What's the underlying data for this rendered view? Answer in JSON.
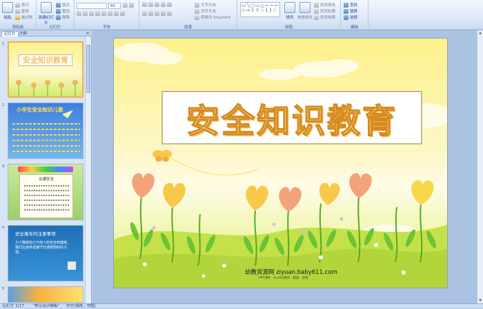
{
  "ribbon": {
    "clipboard": {
      "label": "剪贴板",
      "paste": "粘贴",
      "cut": "剪切",
      "copy": "复制",
      "format_painter": "格式刷"
    },
    "slides": {
      "label": "幻灯片",
      "new_slide": "新建幻灯片",
      "layout": "版式",
      "reset": "重设",
      "delete": "删除"
    },
    "font": {
      "label": "字体",
      "size": "80"
    },
    "paragraph": {
      "label": "段落",
      "text_direction": "文字方向",
      "align_text": "对齐文本",
      "smartart": "转换为 SmartArt"
    },
    "drawing": {
      "label": "绘图",
      "arrange": "排列",
      "quick_styles": "快速样式",
      "shape_fill": "形状填充",
      "shape_outline": "形状轮廓",
      "shape_effects": "形状效果"
    },
    "editing": {
      "label": "编辑",
      "find": "查找",
      "replace": "替换",
      "select": "选择"
    }
  },
  "panel": {
    "tab_slides": "幻灯片",
    "tab_outline": "大纲",
    "close": "×",
    "thumbs": [
      {
        "num": "1",
        "title": "安全知识教育"
      },
      {
        "num": "2",
        "title": "小学生安全知识儿歌"
      },
      {
        "num": "3",
        "title": "交通安全"
      },
      {
        "num": "4",
        "title": "安全乘车的注意事项",
        "body": "为了确保自己与他人的安全和健康，我们应该养成遵守交通规则的好习惯。"
      },
      {
        "num": "5"
      }
    ]
  },
  "slide": {
    "title": "安全知识教育",
    "footer": "幼教资源网 ziyuan.baby611.com",
    "footer_sub": "PPT课件 · FLASH课件 · 教案 · 试卷"
  },
  "status": {
    "slide_num": "幻灯片 1/17",
    "theme": "\"默认设计模板\"",
    "language": "中文(简体，中国)"
  },
  "colors": {
    "title_fill": "#fff4c0",
    "title_outline": "#d68a1f",
    "selection": "#f0b04a"
  }
}
